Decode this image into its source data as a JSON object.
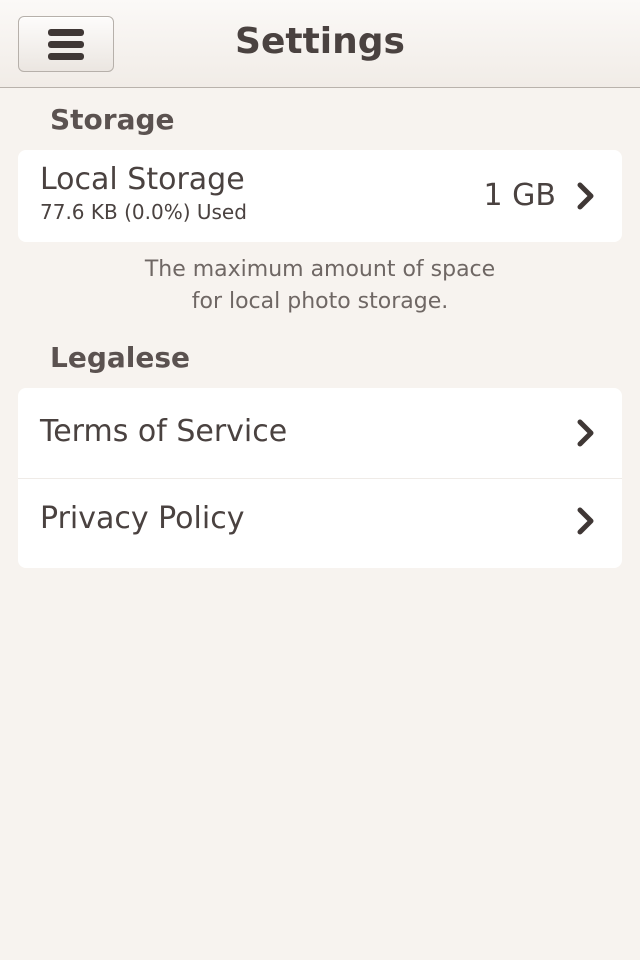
{
  "navbar": {
    "title": "Settings",
    "menu_icon": "hamburger-icon"
  },
  "storage": {
    "header": "Storage",
    "local_storage": {
      "title": "Local Storage",
      "subtitle": "77.6 KB (0.0%) Used",
      "value": "1 GB",
      "icon": "chevron-right-icon"
    },
    "note_line1": "The maximum amount of space",
    "note_line2": "for local photo storage."
  },
  "legalese": {
    "header": "Legalese",
    "items": [
      {
        "label": "Terms of Service",
        "icon": "chevron-right-icon"
      },
      {
        "label": "Privacy Policy",
        "icon": "chevron-right-icon"
      }
    ]
  },
  "colors": {
    "background": "#f7f3ef",
    "text": "#4a4240",
    "card": "#ffffff"
  }
}
